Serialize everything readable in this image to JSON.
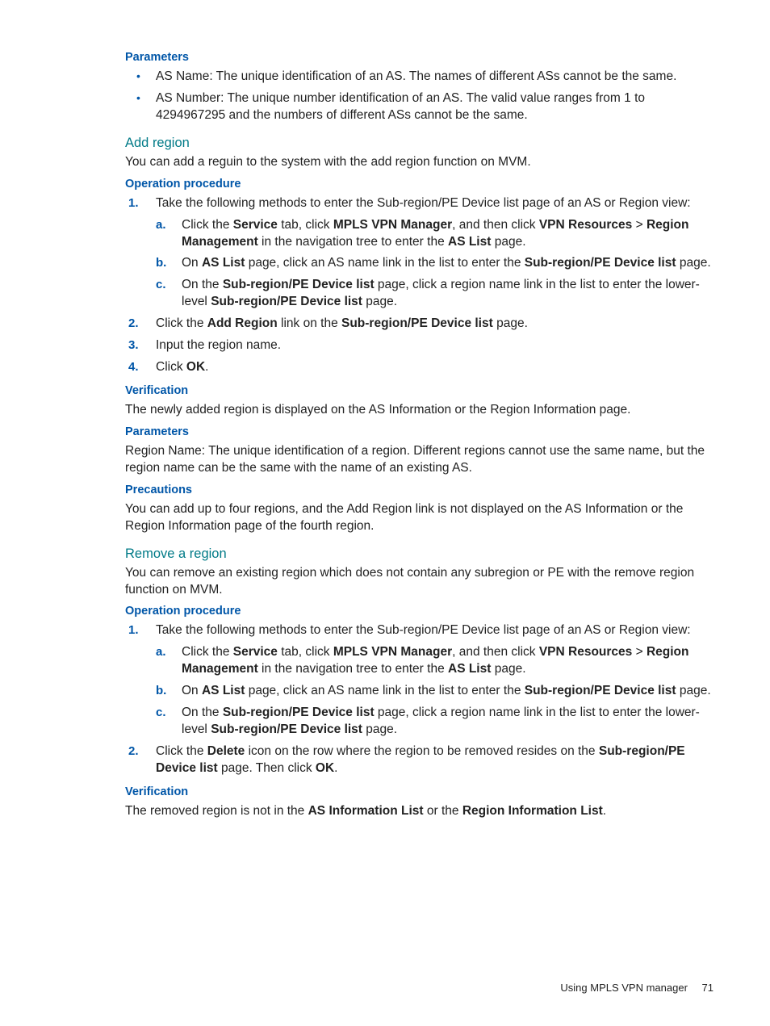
{
  "sec1": {
    "heading": "Parameters",
    "bullet1": "AS Name: The unique identification of an AS. The names of different ASs cannot be the same.",
    "bullet2": "AS Number: The unique number identification of an AS. The valid value ranges from 1 to 4294967295 and the numbers of different ASs cannot be the same."
  },
  "addRegion": {
    "heading": "Add region",
    "intro": "You can add a reguin to the system with the add region function on MVM.",
    "opHeading": "Operation procedure",
    "s1_intro": "Take the following methods to enter the Sub-region/PE Device list page of an AS or Region view:",
    "s1a_1": "Click the ",
    "s1a_b1": "Service",
    "s1a_2": " tab, click ",
    "s1a_b2": "MPLS VPN Manager",
    "s1a_3": ", and then click ",
    "s1a_b3": "VPN Resources",
    "s1a_gt": " > ",
    "s1a_b4": "Region Management",
    "s1a_4": " in the navigation tree to enter the ",
    "s1a_b5": "AS List",
    "s1a_5": " page.",
    "s1b_1": "On ",
    "s1b_b1": "AS List",
    "s1b_2": " page, click an AS name link in the list to enter the ",
    "s1b_b2": "Sub-region/PE Device list",
    "s1b_3": " page.",
    "s1c_1": "On the ",
    "s1c_b1": "Sub-region/PE Device list",
    "s1c_2": " page, click a region name link in the list to enter the lower-level ",
    "s1c_b2": "Sub-region/PE Device list",
    "s1c_3": " page.",
    "s2_1": "Click the ",
    "s2_b1": "Add Region",
    "s2_2": " link on the ",
    "s2_b2": "Sub-region/PE Device list",
    "s2_3": " page.",
    "s3": "Input the region name.",
    "s4_1": "Click ",
    "s4_b1": "OK",
    "s4_2": ".",
    "verHeading": "Verification",
    "verText": "The newly added region is displayed on the AS Information or the Region Information page.",
    "parHeading": "Parameters",
    "parText": "Region Name: The unique identification of a region. Different regions cannot use the same name, but the region name can be the same with the name of an existing AS.",
    "preHeading": "Precautions",
    "preText": "You can add up to four regions, and the Add Region link is not displayed on the AS Information or the Region Information page of the fourth region."
  },
  "removeRegion": {
    "heading": "Remove a region",
    "intro": "You can remove an existing region which does not contain any subregion or PE with the remove region function on MVM.",
    "opHeading": "Operation procedure",
    "s1_intro": "Take the following methods to enter the Sub-region/PE Device list page of an AS or Region view:",
    "s1a_1": "Click the ",
    "s1a_b1": "Service",
    "s1a_2": " tab, click ",
    "s1a_b2": "MPLS VPN Manager",
    "s1a_3": ", and then click ",
    "s1a_b3": "VPN Resources",
    "s1a_gt": " > ",
    "s1a_b4": "Region Management",
    "s1a_4": " in the navigation tree to enter the ",
    "s1a_b5": "AS List",
    "s1a_5": " page.",
    "s1b_1": "On ",
    "s1b_b1": "AS List",
    "s1b_2": " page, click an AS name link in the list to enter the ",
    "s1b_b2": "Sub-region/PE Device list",
    "s1b_3": " page.",
    "s1c_1": "On the ",
    "s1c_b1": "Sub-region/PE Device list",
    "s1c_2": " page, click a region name link in the list to enter the lower-level ",
    "s1c_b2": "Sub-region/PE Device list",
    "s1c_3": " page.",
    "s2_1": "Click the ",
    "s2_b1": "Delete",
    "s2_2": " icon on the row where the region to be removed resides on the ",
    "s2_b2": "Sub-region/PE Device list",
    "s2_3": " page. Then click ",
    "s2_b3": "OK",
    "s2_4": ".",
    "verHeading": "Verification",
    "ver_1": "The removed region is not in the ",
    "ver_b1": "AS Information List",
    "ver_2": " or the ",
    "ver_b2": "Region Information List",
    "ver_3": "."
  },
  "footer": {
    "text": "Using MPLS VPN manager",
    "page": "71"
  }
}
